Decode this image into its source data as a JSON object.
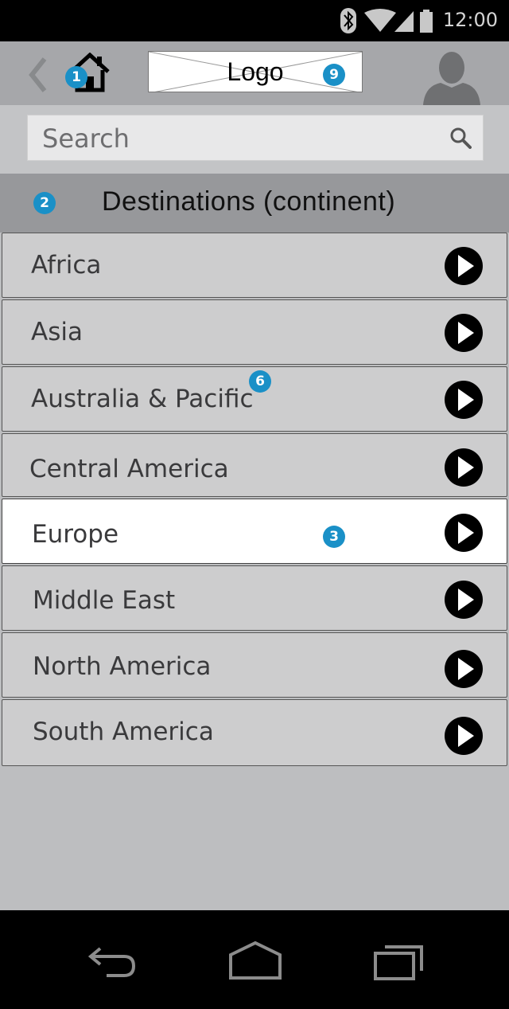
{
  "status_bar": {
    "time": "12:00",
    "icons": [
      "bluetooth-icon",
      "wifi-icon",
      "signal-icon",
      "battery-icon"
    ]
  },
  "app_bar": {
    "logo_text": "Logo"
  },
  "badges": {
    "home": "1",
    "header": "2",
    "selected": "3",
    "list": "6",
    "logo": "9"
  },
  "search": {
    "placeholder": "Search"
  },
  "section": {
    "title": "Destinations (continent)"
  },
  "destinations": [
    {
      "label": "Africa"
    },
    {
      "label": "Asia"
    },
    {
      "label": "Australia & Pacific"
    },
    {
      "label": "Central America"
    },
    {
      "label": "Europe",
      "selected": true
    },
    {
      "label": "Middle East"
    },
    {
      "label": "North America"
    },
    {
      "label": "South America"
    }
  ],
  "colors": {
    "badge": "#1a90c7",
    "app_bar": "#a6a7aa",
    "list_bg": "#cdcdce",
    "selected_bg": "#ffffff"
  }
}
